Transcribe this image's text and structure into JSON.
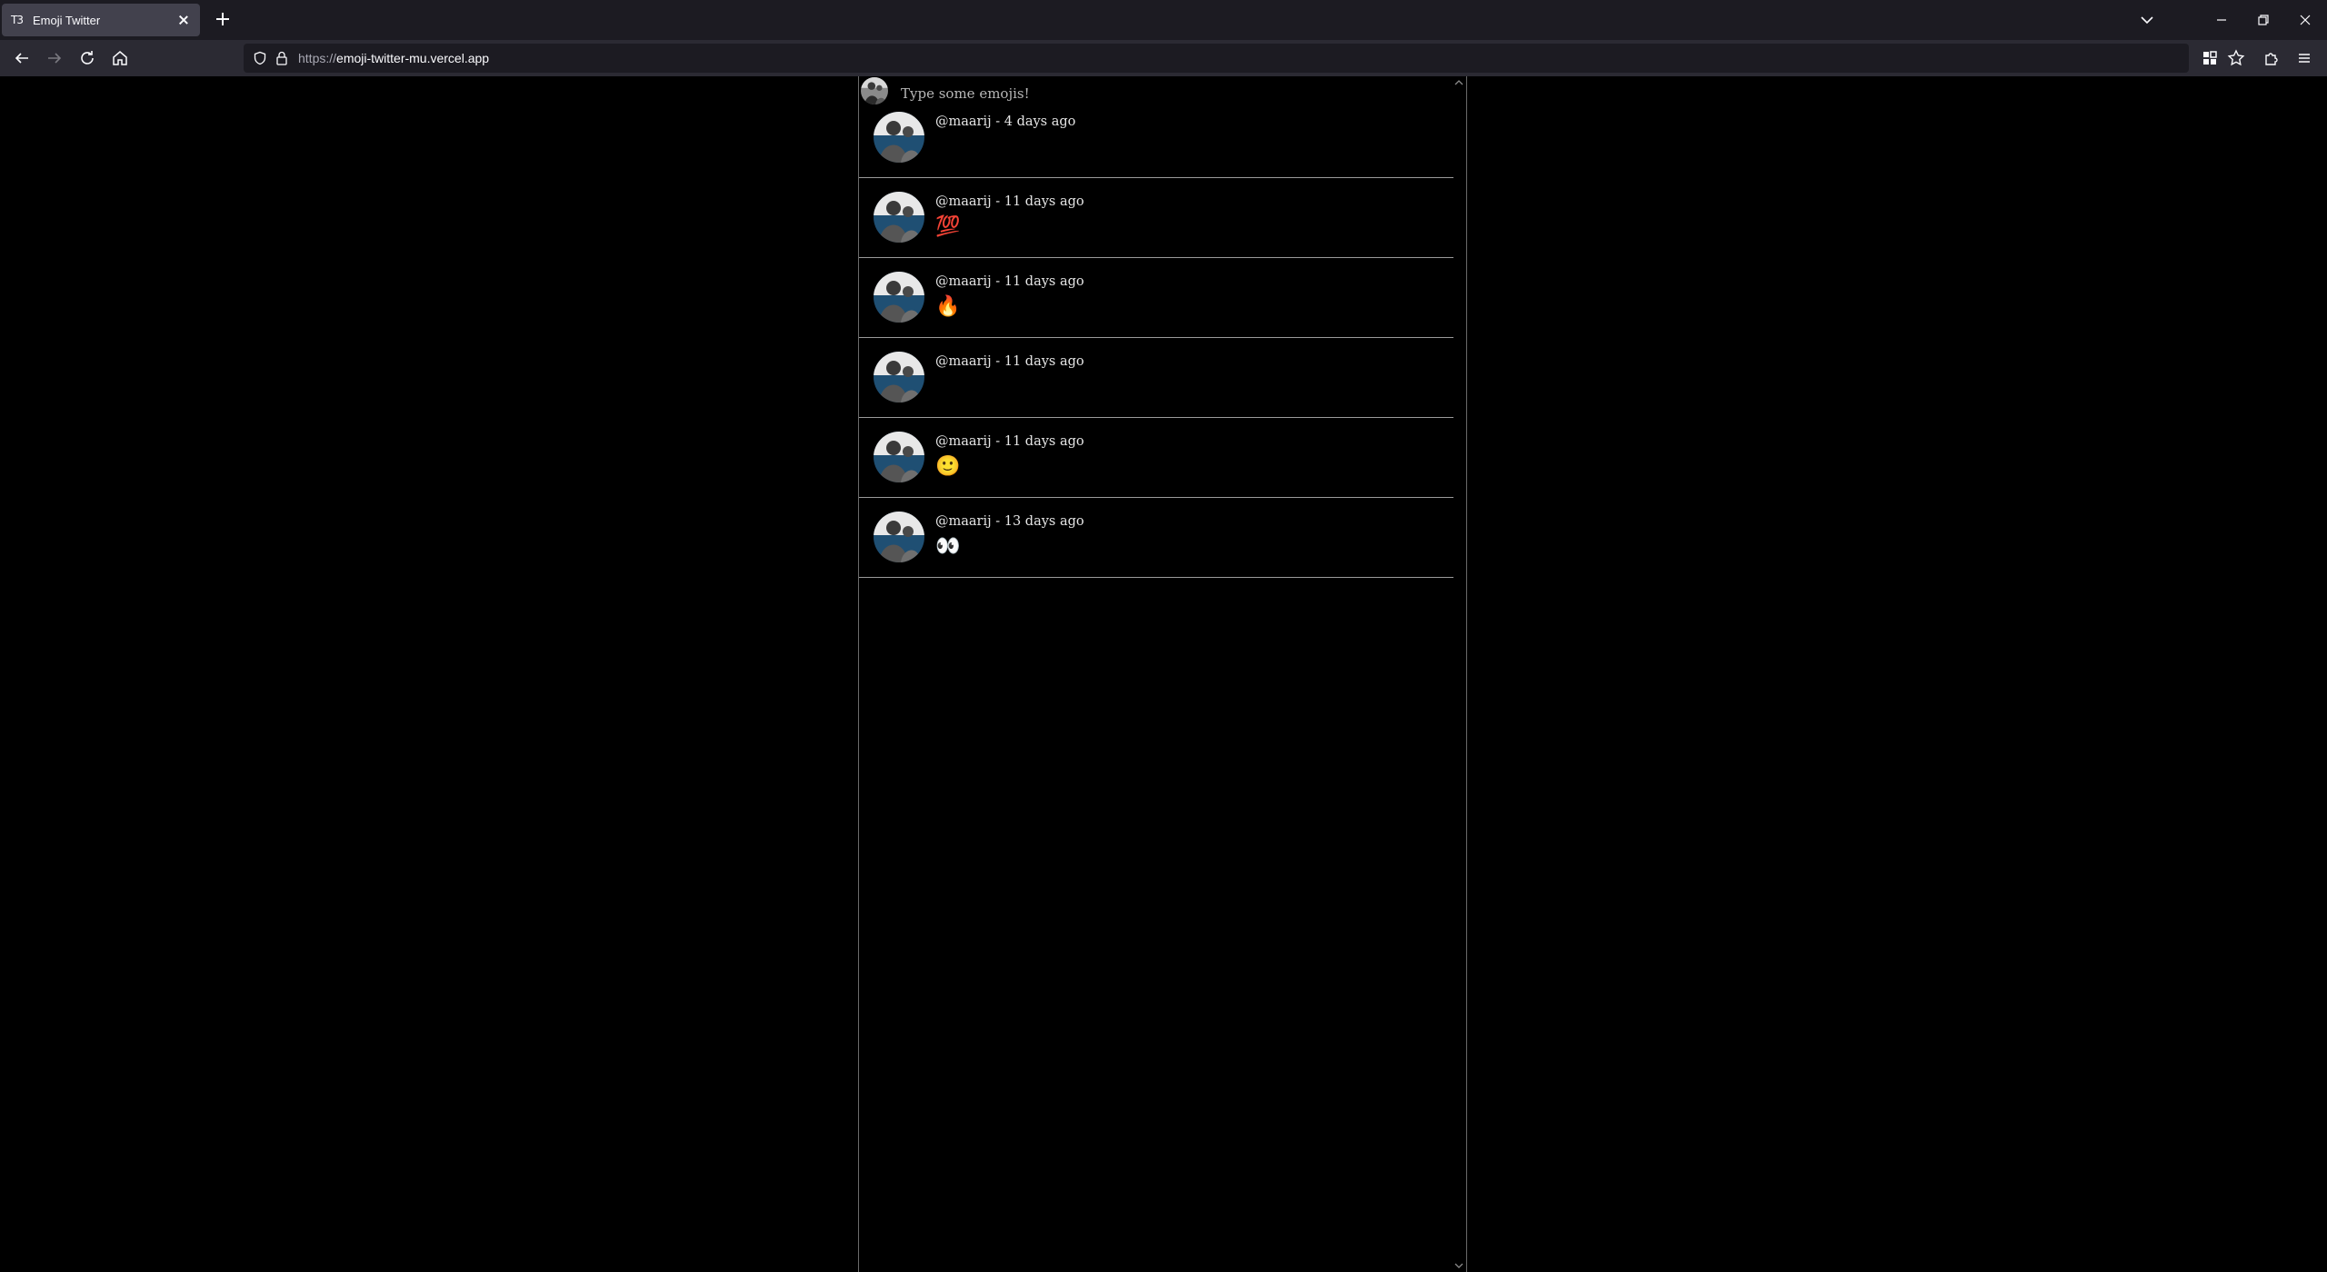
{
  "browser": {
    "tab": {
      "title": "Emoji Twitter",
      "favicon_text": "T3"
    },
    "url": {
      "scheme": "https://",
      "host": "emoji-twitter-mu.vercel.app"
    }
  },
  "composer": {
    "placeholder": "Type some emojis!"
  },
  "posts": [
    {
      "author": "@maarij",
      "separator": " - ",
      "time": "4 days ago",
      "emoji": "😆"
    },
    {
      "author": "@maarij",
      "separator": " - ",
      "time": "11 days ago",
      "emoji": "💯"
    },
    {
      "author": "@maarij",
      "separator": " - ",
      "time": "11 days ago",
      "emoji": "🔥"
    },
    {
      "author": "@maarij",
      "separator": " - ",
      "time": "11 days ago",
      "emoji": "😐"
    },
    {
      "author": "@maarij",
      "separator": " - ",
      "time": "11 days ago",
      "emoji": "🙂"
    },
    {
      "author": "@maarij",
      "separator": " - ",
      "time": "13 days ago",
      "emoji": "👀"
    }
  ],
  "colors": {
    "page_bg": "#000000",
    "tabbar_bg": "#1c1b22",
    "navbar_bg": "#2b2a33",
    "divider": "#9a9a9a"
  }
}
